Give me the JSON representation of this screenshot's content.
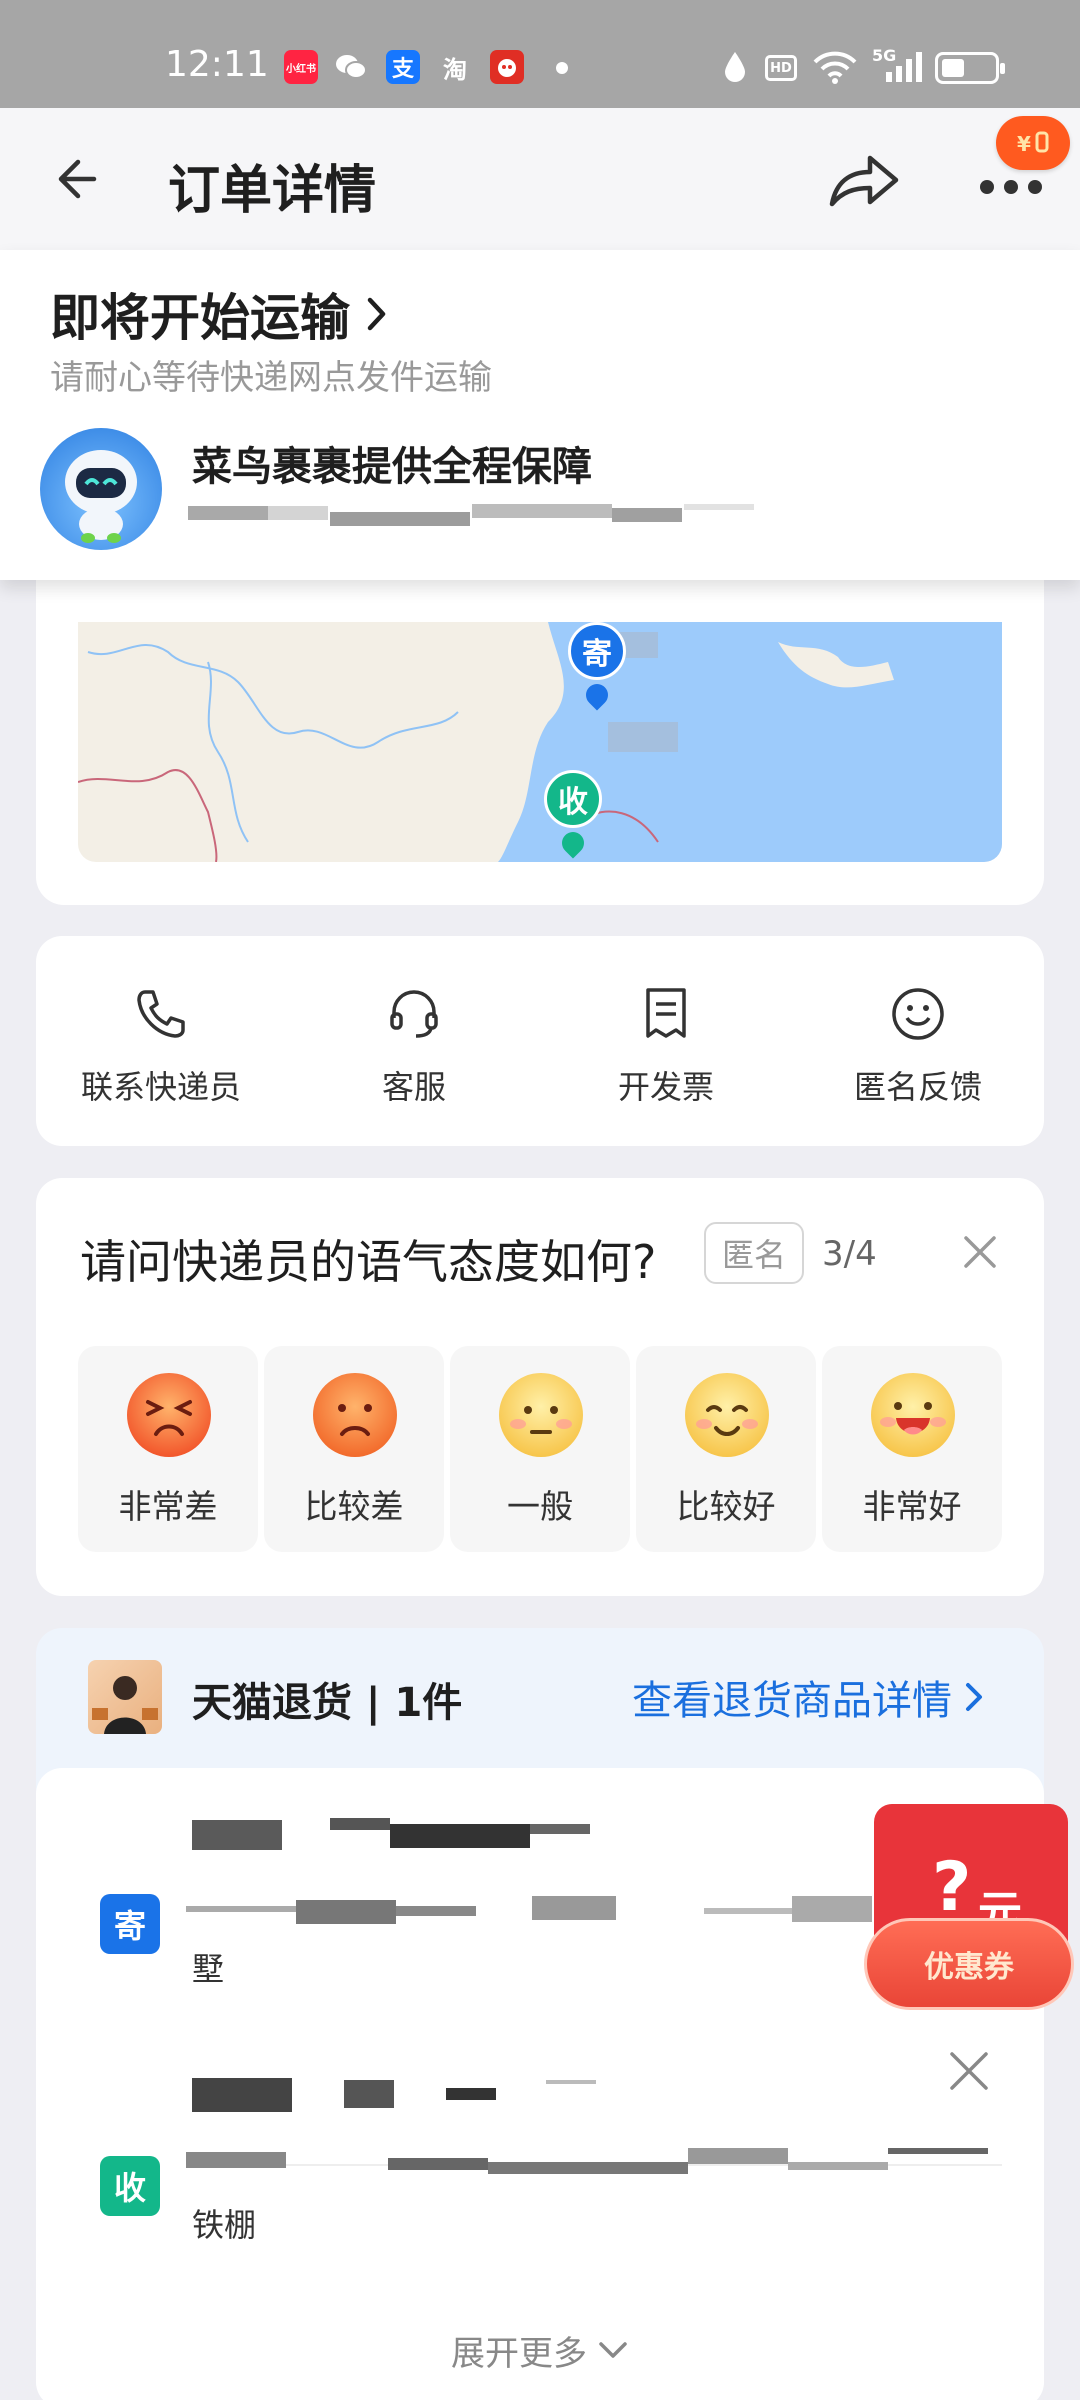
{
  "status_bar": {
    "time": "12:11",
    "apps": [
      {
        "name": "xiaohongshu",
        "label": "小红书",
        "color": "#ff2442"
      },
      {
        "name": "wechat",
        "label": "",
        "color": "#a6a6a6"
      },
      {
        "name": "alipay",
        "label": "支",
        "color": "#1677ff"
      },
      {
        "name": "taobao",
        "label": "淘",
        "color": "#a6a6a6"
      },
      {
        "name": "pinduoduo",
        "label": "",
        "color": "#e02e24"
      }
    ],
    "hd_label": "HD",
    "net_label": "5G"
  },
  "nav": {
    "title": "订单详情"
  },
  "shipment": {
    "status": "即将开始运输",
    "subtitle": "请耐心等待快递网点发件运输",
    "guarantee": "菜鸟裹裹提供全程保障"
  },
  "map": {
    "send_marker": "寄",
    "receive_marker": "收"
  },
  "services": [
    {
      "label": "联系快递员",
      "icon": "phone-icon"
    },
    {
      "label": "客服",
      "icon": "headset-icon"
    },
    {
      "label": "开发票",
      "icon": "invoice-icon"
    },
    {
      "label": "匿名反馈",
      "icon": "smile-icon"
    }
  ],
  "rating": {
    "question": "请问快递员的语气态度如何?",
    "anon_label": "匿名",
    "progress": "3/4",
    "options": [
      {
        "label": "非常差",
        "face": "very-bad"
      },
      {
        "label": "比较差",
        "face": "bad"
      },
      {
        "label": "一般",
        "face": "neutral"
      },
      {
        "label": "比较好",
        "face": "good"
      },
      {
        "label": "非常好",
        "face": "very-good"
      }
    ]
  },
  "return": {
    "title": "天猫退货 | 1件",
    "link": "查看退货商品详情",
    "sender_tag": "寄",
    "sender_tail": "墅",
    "receiver_tag": "收",
    "receiver_tail": "铁棚",
    "expand_label": "展开更多"
  },
  "coupon": {
    "amount": "?",
    "unit": "元",
    "label": "优惠券"
  },
  "colors": {
    "accent_blue": "#1a6fde",
    "send_blue": "#1a73e8",
    "receive_green": "#13b78a",
    "coupon_red": "#e8343a"
  }
}
